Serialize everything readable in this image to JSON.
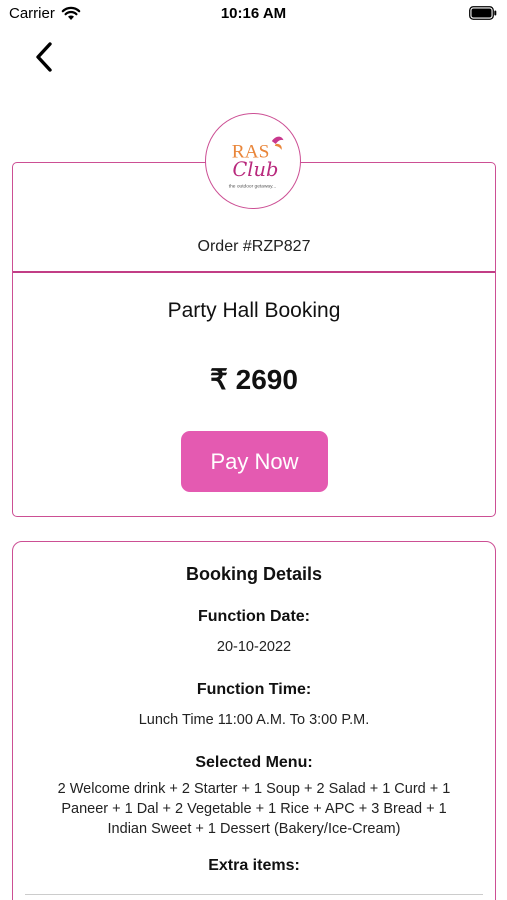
{
  "status_bar": {
    "carrier": "Carrier",
    "time": "10:16 AM"
  },
  "header": {
    "back_icon": "chevron-left-icon"
  },
  "logo": {
    "brand_top": "RAS",
    "brand_script": "Club",
    "tagline": "the outdoor getaway..."
  },
  "order": {
    "number": "Order #RZP827",
    "service": "Party Hall Booking",
    "amount": "₹ 2690",
    "pay_label": "Pay Now"
  },
  "booking_details": {
    "title": "Booking Details",
    "function_date_label": "Function Date:",
    "function_date": "20-10-2022",
    "function_time_label": "Function Time:",
    "function_time": "Lunch Time 11:00 A.M. To 3:00 P.M.",
    "selected_menu_label": "Selected Menu:",
    "selected_menu": "2 Welcome drink + 2 Starter + 1 Soup +  2 Salad + 1 Curd + 1 Paneer  + 1 Dal + 2 Vegetable + 1 Rice + APC + 3 Bread + 1 Indian Sweet + 1 Dessert (Bakery/Ice-Cream)",
    "extra_items_label": "Extra items:"
  },
  "colors": {
    "accent": "#cc4f94",
    "button": "#e45ab1",
    "logo_orange": "#e9863a",
    "logo_magenta": "#b8287c"
  }
}
